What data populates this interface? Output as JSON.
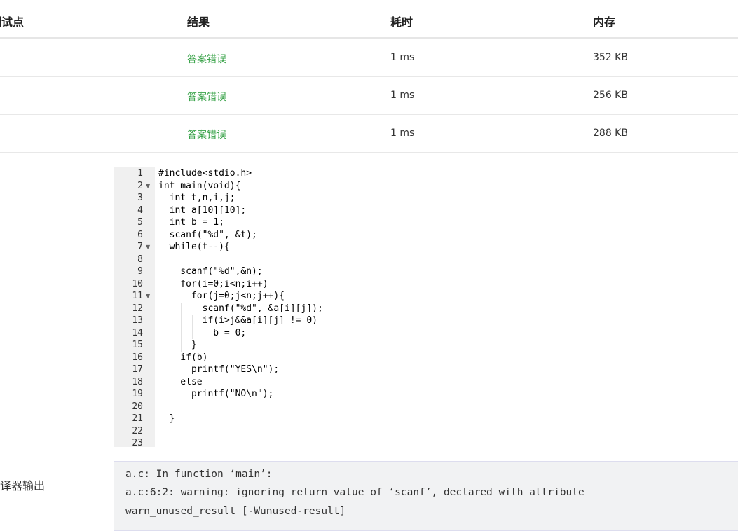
{
  "table": {
    "headers": [
      "测试点",
      "结果",
      "耗时",
      "内存"
    ],
    "rows": [
      {
        "point": "",
        "status": "答案错误",
        "time": "1 ms",
        "memory": "352 KB"
      },
      {
        "point": "",
        "status": "答案错误",
        "time": "1 ms",
        "memory": "256 KB"
      },
      {
        "point": "",
        "status": "答案错误",
        "time": "1 ms",
        "memory": "288 KB"
      }
    ],
    "status_color": "#3aa34a"
  },
  "code": {
    "line_numbers": [
      "1",
      "2",
      "3",
      "4",
      "5",
      "6",
      "7",
      "8",
      "9",
      "10",
      "11",
      "12",
      "13",
      "14",
      "15",
      "16",
      "17",
      "18",
      "19",
      "20",
      "21",
      "22",
      "23"
    ],
    "folded_lines": [
      2,
      7,
      11
    ],
    "lines": [
      "#include<stdio.h>",
      "int main(void){",
      "  int t,n,i,j;",
      "  int a[10][10];",
      "  int b = 1;",
      "  scanf(\"%d\", &t);",
      "  while(t--){",
      "",
      "    scanf(\"%d\",&n);",
      "    for(i=0;i<n;i++)",
      "      for(j=0;j<n;j++){",
      "        scanf(\"%d\", &a[i][j]);",
      "        if(i>j&&a[i][j] != 0)",
      "          b = 0;",
      "      }",
      "    if(b)",
      "      printf(\"YES\\n\");",
      "    else",
      "      printf(\"NO\\n\");",
      "",
      "  }",
      "",
      ""
    ]
  },
  "compiler_output": {
    "label": "编译器输出",
    "lines": [
      "a.c: In function ‘main’:",
      "a.c:6:2: warning: ignoring return value of ‘scanf’, declared with attribute",
      "warn_unused_result [-Wunused-result]"
    ]
  }
}
